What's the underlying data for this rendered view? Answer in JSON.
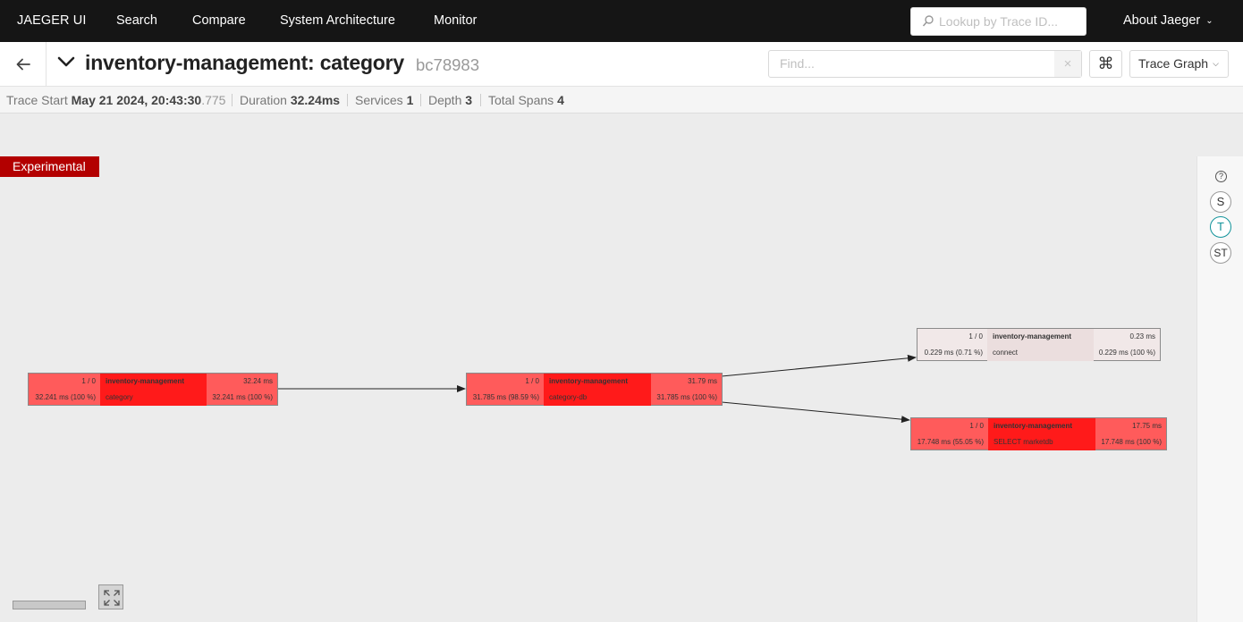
{
  "nav": {
    "brand": "JAEGER UI",
    "links": [
      "Search",
      "Compare",
      "System Architecture",
      "Monitor"
    ],
    "lookup_placeholder": "Lookup by Trace ID...",
    "about": "About Jaeger"
  },
  "trace": {
    "title": "inventory-management: category",
    "trace_id": "bc78983",
    "find_placeholder": "Find...",
    "view_mode": "Trace Graph",
    "shortcut_icon": "⌘"
  },
  "summary": {
    "trace_start_label": "Trace Start",
    "trace_start_value": "May 21 2024, 20:43:30",
    "trace_start_ms": ".775",
    "duration_label": "Duration",
    "duration_value": "32.24ms",
    "services_label": "Services",
    "services_value": "1",
    "depth_label": "Depth",
    "depth_value": "3",
    "total_spans_label": "Total Spans",
    "total_spans_value": "4"
  },
  "graph": {
    "badge": "Experimental",
    "nodes": [
      {
        "count": "1 / 0",
        "service": "inventory-management",
        "duration": "32.24 ms",
        "self_time": "32.241 ms (100 %)",
        "operation": "category",
        "self_pct": "32.241 ms (100 %)",
        "color": "#ff5b5b"
      },
      {
        "count": "1 / 0",
        "service": "inventory-management",
        "duration": "31.79 ms",
        "self_time": "31.785 ms (98.59 %)",
        "operation": "category-db",
        "self_pct": "31.785 ms (100 %)",
        "color": "#ff5b5b"
      },
      {
        "count": "1 / 0",
        "service": "inventory-management",
        "duration": "0.23 ms",
        "self_time": "0.229 ms (0.71 %)",
        "operation": "connect",
        "self_pct": "0.229 ms (100 %)",
        "color": "#f1e8e8"
      },
      {
        "count": "1 / 0",
        "service": "inventory-management",
        "duration": "17.75 ms",
        "self_time": "17.748 ms (55.05 %)",
        "operation": "SELECT marketdb",
        "self_pct": "17.748 ms (100 %)",
        "color": "#ff5b5b"
      }
    ]
  },
  "side": {
    "help": "?",
    "modes": [
      "S",
      "T",
      "ST"
    ],
    "active_mode": "T"
  },
  "icons": {
    "lookup": "search-icon",
    "back": "arrow-left-icon",
    "collapse": "chevron-down-icon",
    "clear": "close-icon",
    "fit": "expand-icon"
  }
}
